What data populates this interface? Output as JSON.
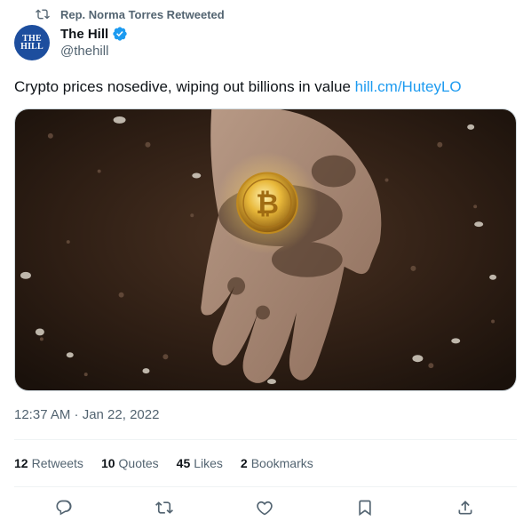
{
  "retweet": {
    "label": "Rep. Norma Torres Retweeted",
    "icon": "retweet-icon"
  },
  "author": {
    "display_name": "The Hill",
    "handle": "@thehill",
    "avatar_line1": "THE",
    "avatar_line2": "HILL",
    "verified_icon": "verified-badge-icon"
  },
  "tweet": {
    "text": "Crypto prices nosedive, wiping out billions in value ",
    "link": "hill.cm/HuteyLO",
    "timestamp": "12:37 AM · Jan 22, 2022"
  },
  "stats": {
    "retweets_count": "12",
    "retweets_label": "Retweets",
    "quotes_count": "10",
    "quotes_label": "Quotes",
    "likes_count": "45",
    "likes_label": "Likes",
    "bookmarks_count": "2",
    "bookmarks_label": "Bookmarks"
  },
  "actions": [
    "reply-icon",
    "retweet-icon",
    "like-icon",
    "bookmark-icon",
    "share-icon"
  ],
  "colors": {
    "link": "#1d9bf0",
    "muted": "#536471",
    "text": "#0f1419",
    "verified": "#1d9bf0"
  }
}
